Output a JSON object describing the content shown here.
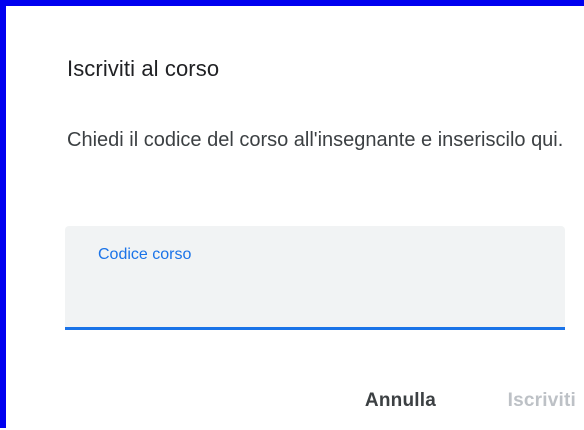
{
  "dialog": {
    "title": "Iscriviti al corso",
    "description": "Chiedi il codice del corso all'insegnante e inseriscilo qui.",
    "field": {
      "label": "Codice corso",
      "value": "",
      "state": "focused"
    },
    "buttons": {
      "cancel_label": "Annulla",
      "join_label": "Iscriviti",
      "join_enabled": false
    }
  },
  "colors": {
    "frame_border": "#0000f0",
    "accent": "#1a73e8",
    "field_background": "#f1f3f4",
    "disabled_text": "#bdc1c6"
  }
}
